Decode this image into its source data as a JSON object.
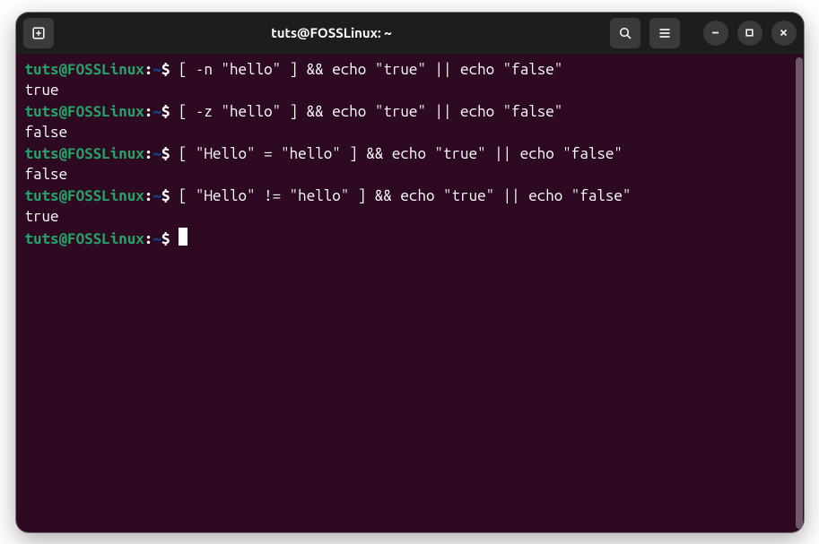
{
  "window": {
    "title": "tuts@FOSSLinux: ~"
  },
  "icons": {
    "new_tab": "new-tab-icon",
    "search": "search-icon",
    "menu": "hamburger-icon",
    "minimize": "minimize-icon",
    "maximize": "maximize-icon",
    "close": "close-icon"
  },
  "prompt": {
    "user_host": "tuts@FOSSLinux",
    "colon": ":",
    "path": "~",
    "symbol": "$"
  },
  "lines": [
    {
      "type": "cmd",
      "command": "[ -n \"hello\" ] && echo \"true\" || echo \"false\""
    },
    {
      "type": "out",
      "text": "true"
    },
    {
      "type": "cmd",
      "command": "[ -z \"hello\" ] && echo \"true\" || echo \"false\""
    },
    {
      "type": "out",
      "text": "false"
    },
    {
      "type": "cmd",
      "command": "[ \"Hello\" = \"hello\" ] && echo \"true\" || echo \"false\""
    },
    {
      "type": "out",
      "text": "false"
    },
    {
      "type": "cmd",
      "command": "[ \"Hello\" != \"hello\" ] && echo \"true\" || echo \"false\""
    },
    {
      "type": "out",
      "text": "true"
    },
    {
      "type": "prompt-cursor"
    }
  ]
}
